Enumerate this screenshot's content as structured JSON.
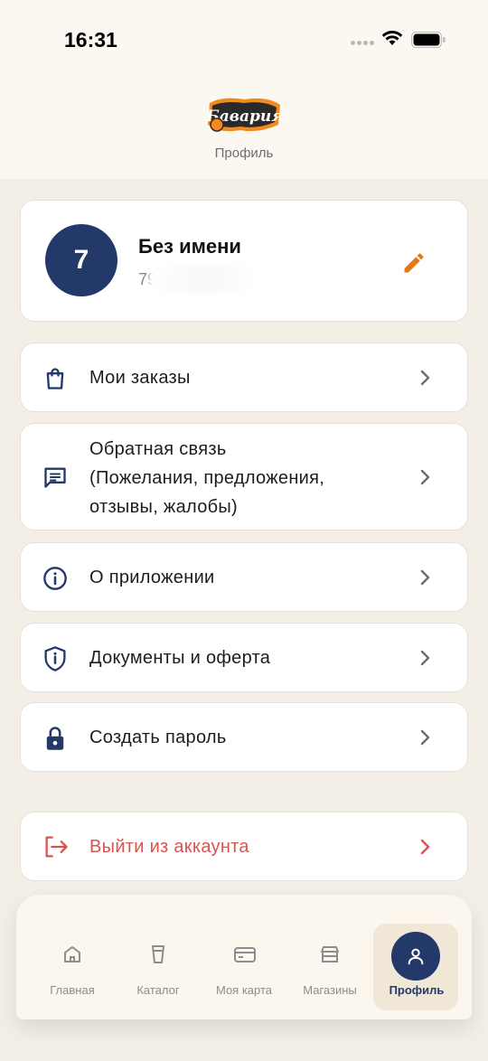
{
  "status": {
    "time": "16:31"
  },
  "header": {
    "logo_text": "Бавария",
    "title": "Профиль"
  },
  "profile": {
    "avatar_text": "7",
    "name": "Без имени",
    "phone": "79"
  },
  "menu": [
    {
      "label": "Мои заказы",
      "icon": "bag-icon"
    },
    {
      "label_lines": [
        "Обратная связь",
        "(Пожелания, предложения,",
        "отзывы, жалобы)"
      ],
      "icon": "message-icon"
    },
    {
      "label": "О приложении",
      "icon": "info-icon"
    },
    {
      "label": "Документы и оферта",
      "icon": "shield-icon"
    },
    {
      "label": "Создать пароль",
      "icon": "lock-icon"
    }
  ],
  "logout": {
    "label": "Выйти из аккаунта",
    "icon": "logout-icon",
    "color": "#d9534f"
  },
  "nav": [
    {
      "label": "Главная",
      "icon": "home-icon"
    },
    {
      "label": "Каталог",
      "icon": "cup-icon"
    },
    {
      "label": "Моя карта",
      "icon": "card-icon"
    },
    {
      "label": "Магазины",
      "icon": "store-icon"
    },
    {
      "label": "Профиль",
      "icon": "user-icon",
      "active": true
    }
  ],
  "colors": {
    "accent": "#22396a",
    "edit": "#e07b1a",
    "background": "#f3efe6",
    "danger": "#d9534f"
  }
}
